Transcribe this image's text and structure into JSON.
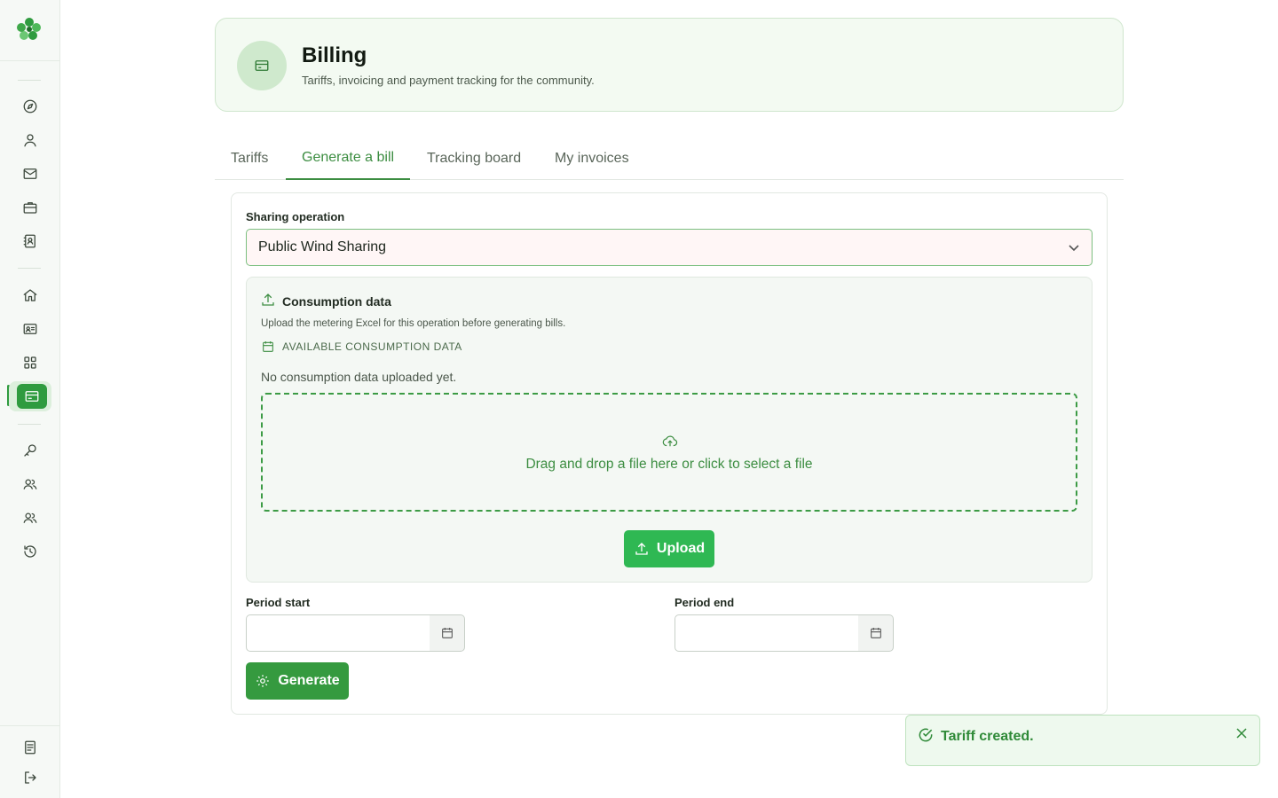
{
  "header": {
    "title": "Billing",
    "subtitle": "Tariffs, invoicing and payment tracking for the community."
  },
  "sidebar": {
    "items": [
      {
        "icon": "compass-icon"
      },
      {
        "icon": "user-icon"
      },
      {
        "icon": "mail-icon"
      },
      {
        "icon": "briefcase-icon"
      },
      {
        "icon": "contact-book-icon"
      },
      {
        "icon": "home-icon"
      },
      {
        "icon": "id-card-icon"
      },
      {
        "icon": "grid-icon"
      },
      {
        "icon": "billing-card-icon",
        "active": true
      },
      {
        "icon": "key-icon"
      },
      {
        "icon": "users-icon"
      },
      {
        "icon": "users-group-icon"
      },
      {
        "icon": "history-icon"
      }
    ],
    "bottom": [
      {
        "icon": "document-icon"
      },
      {
        "icon": "logout-icon"
      }
    ]
  },
  "tabs": [
    {
      "label": "Tariffs"
    },
    {
      "label": "Generate a bill",
      "active": true
    },
    {
      "label": "Tracking board"
    },
    {
      "label": "My invoices"
    }
  ],
  "form": {
    "sharing_label": "Sharing operation",
    "sharing_value": "Public Wind Sharing",
    "consumption": {
      "title": "Consumption data",
      "description": "Upload the metering Excel for this operation before generating bills.",
      "available_label": "AVAILABLE CONSUMPTION DATA",
      "empty_text": "No consumption data uploaded yet.",
      "dropzone_text": "Drag and drop a file here or click to select a file",
      "upload_label": "Upload"
    },
    "period_start_label": "Period start",
    "period_end_label": "Period end",
    "period_start_value": "",
    "period_end_value": "",
    "generate_label": "Generate"
  },
  "toast": {
    "message": "Tariff created."
  },
  "colors": {
    "accent": "#3c8d41",
    "upload_button": "#2fb853",
    "generate_button": "#359a3f"
  }
}
